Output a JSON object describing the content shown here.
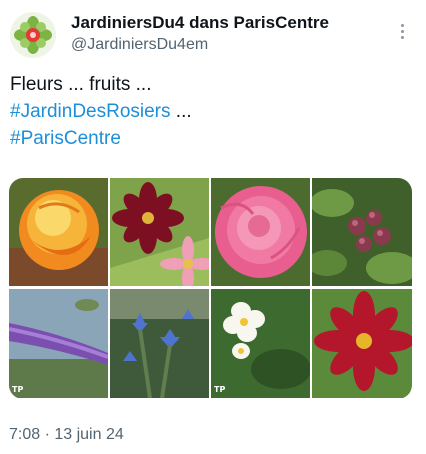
{
  "post": {
    "author_name": "JardiniersDu4 dans ParisCentre",
    "author_handle": "@JardiniersDu4em",
    "text_line1": "Fleurs ... fruits ...",
    "hashtag1": "#JardinDesRosiers",
    "hashtag1_suffix": " ...",
    "hashtag2": "#ParisCentre",
    "timestamp": "7:08 · 13 juin 24",
    "icons": {
      "avatar": "flower-logo-icon",
      "menu": "more-options-icon"
    }
  },
  "media": {
    "badge": "TP",
    "photos": [
      {
        "name": "orange-yellow-rose",
        "color": "#f39a2a"
      },
      {
        "name": "dark-red-cosmos-and-pink-cosmos",
        "color": "#8a1830"
      },
      {
        "name": "pink-rose",
        "color": "#ef6f9b"
      },
      {
        "name": "blackberries",
        "color": "#5e7d3c"
      },
      {
        "name": "purple-buddleia",
        "color": "#7d55b3"
      },
      {
        "name": "blue-borage",
        "color": "#4b6fc2"
      },
      {
        "name": "white-potato-flowers",
        "color": "#f3f1ea"
      },
      {
        "name": "red-cosmos",
        "color": "#b0142a"
      }
    ]
  }
}
